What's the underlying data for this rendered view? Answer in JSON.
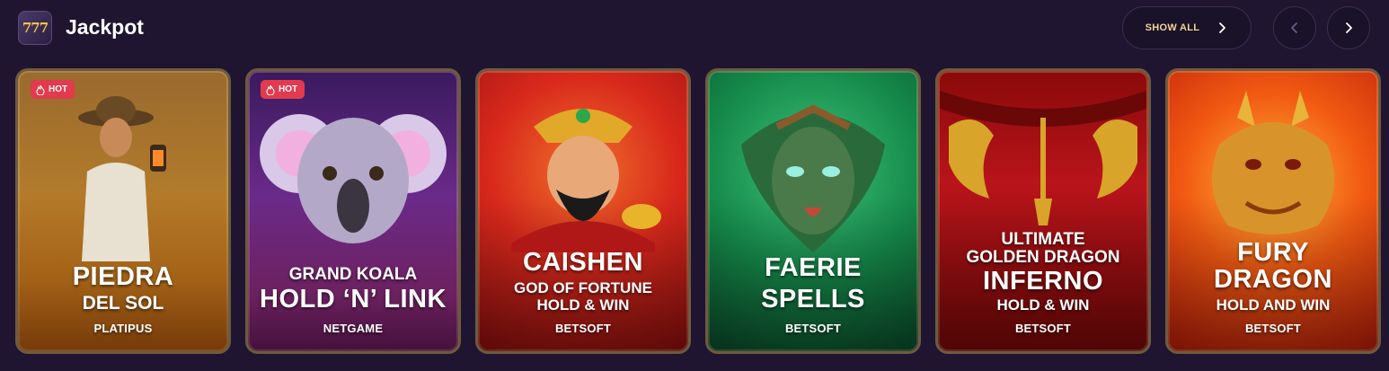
{
  "header": {
    "logo_text": "777",
    "title": "Jackpot",
    "show_all_label": "SHOW ALL",
    "prev_icon": "chevron-left-icon",
    "next_icon": "chevron-right-icon"
  },
  "colors": {
    "background": "#1f1530",
    "accent": "#f2d49a",
    "hot_badge": "#e23a4e"
  },
  "games": [
    {
      "hot_label": "HOT",
      "title_lines": [
        "PIEDRA",
        "DEL SOL"
      ],
      "provider": "PLATIPUS"
    },
    {
      "hot_label": "HOT",
      "title_lines": [
        "GRAND KOALA",
        "HOLD ‘N’ LINK"
      ],
      "provider": "NETGAME"
    },
    {
      "title_lines": [
        "CAISHEN",
        "GOD OF FORTUNE",
        "HOLD & WIN"
      ],
      "provider": "BETSOFT"
    },
    {
      "title_lines": [
        "FAERIE",
        "SPELLS"
      ],
      "provider": "BETSOFT"
    },
    {
      "title_lines": [
        "ULTIMATE",
        "GOLDEN DRAGON",
        "INFERNO",
        "HOLD & WIN"
      ],
      "provider": "BETSOFT"
    },
    {
      "title_lines": [
        "FURY",
        "DRAGON",
        "HOLD AND WIN"
      ],
      "provider": "BETSOFT"
    }
  ]
}
